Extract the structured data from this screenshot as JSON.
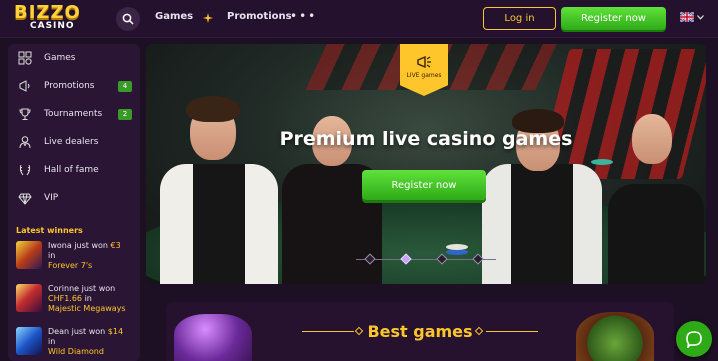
{
  "header": {
    "logo_top": "BIZZO",
    "logo_bottom": "CASINO",
    "nav": {
      "games": "Games",
      "promotions": "Promotions",
      "more": "•••"
    },
    "login_label": "Log in",
    "register_label": "Register now",
    "language": "EN"
  },
  "sidebar": {
    "items": [
      {
        "label": "Games",
        "icon": "games-icon"
      },
      {
        "label": "Promotions",
        "icon": "megaphone-icon",
        "badge": "4"
      },
      {
        "label": "Tournaments",
        "icon": "trophy-icon",
        "badge": "2"
      },
      {
        "label": "Live dealers",
        "icon": "dealer-icon"
      },
      {
        "label": "Hall of fame",
        "icon": "laurel-icon"
      },
      {
        "label": "VIP",
        "icon": "diamond-icon"
      }
    ],
    "latest_title": "Latest winners",
    "winners": [
      {
        "prefix": "Iwona just won ",
        "amount": "€3",
        "in": "in",
        "game": "Forever 7's"
      },
      {
        "prefix": "Corinne just won ",
        "amount": "CHF1.66",
        "in": "in",
        "game": "Majestic Megaways"
      },
      {
        "prefix": "Dean just won ",
        "amount": "$14",
        "in": "in",
        "game": "Wild Diamond"
      }
    ]
  },
  "hero": {
    "badge_label": "LIVE games",
    "title": "Premium live casino games",
    "button_label": "Register now",
    "slides": 4,
    "active_slide": 2
  },
  "best_games": {
    "title": "Best games"
  },
  "colors": {
    "accent": "#ffc62b",
    "green": "#2faa17",
    "bg": "#1d0f24",
    "panel": "#2a1634"
  }
}
